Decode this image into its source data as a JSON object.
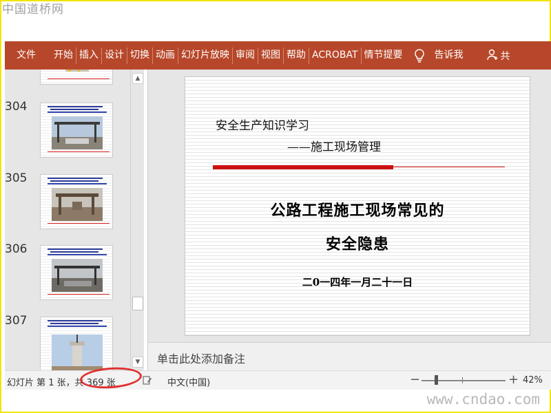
{
  "watermark_top": "中国道桥网",
  "watermark_bottom": "www.cndao.com",
  "ribbon": {
    "tabs": [
      "文件",
      "开始",
      "插入",
      "设计",
      "切换",
      "动画",
      "幻灯片放映",
      "审阅",
      "视图",
      "帮助",
      "ACROBAT",
      "情节提要"
    ],
    "tell_me": "告诉我",
    "share_label": "共"
  },
  "thumbnails": [
    {
      "number": "304"
    },
    {
      "number": "305"
    },
    {
      "number": "306"
    },
    {
      "number": "307"
    }
  ],
  "slide": {
    "subtitle1": "安全生产知识学习",
    "subtitle2": "——施工现场管理",
    "title_line1": "公路工程施工现场常见的",
    "title_line2": "安全隐患",
    "date": "二0一四年一月二十一日",
    "accent_color": "#cc1111"
  },
  "notes_placeholder": "单击此处添加备注",
  "statusbar": {
    "slide_count": "幻灯片 第 1 张，共 369 张",
    "language": "中文(中国)",
    "zoom": "42%"
  },
  "colors": {
    "ribbon": "#b7472a",
    "highlight_ring": "#e03030"
  }
}
